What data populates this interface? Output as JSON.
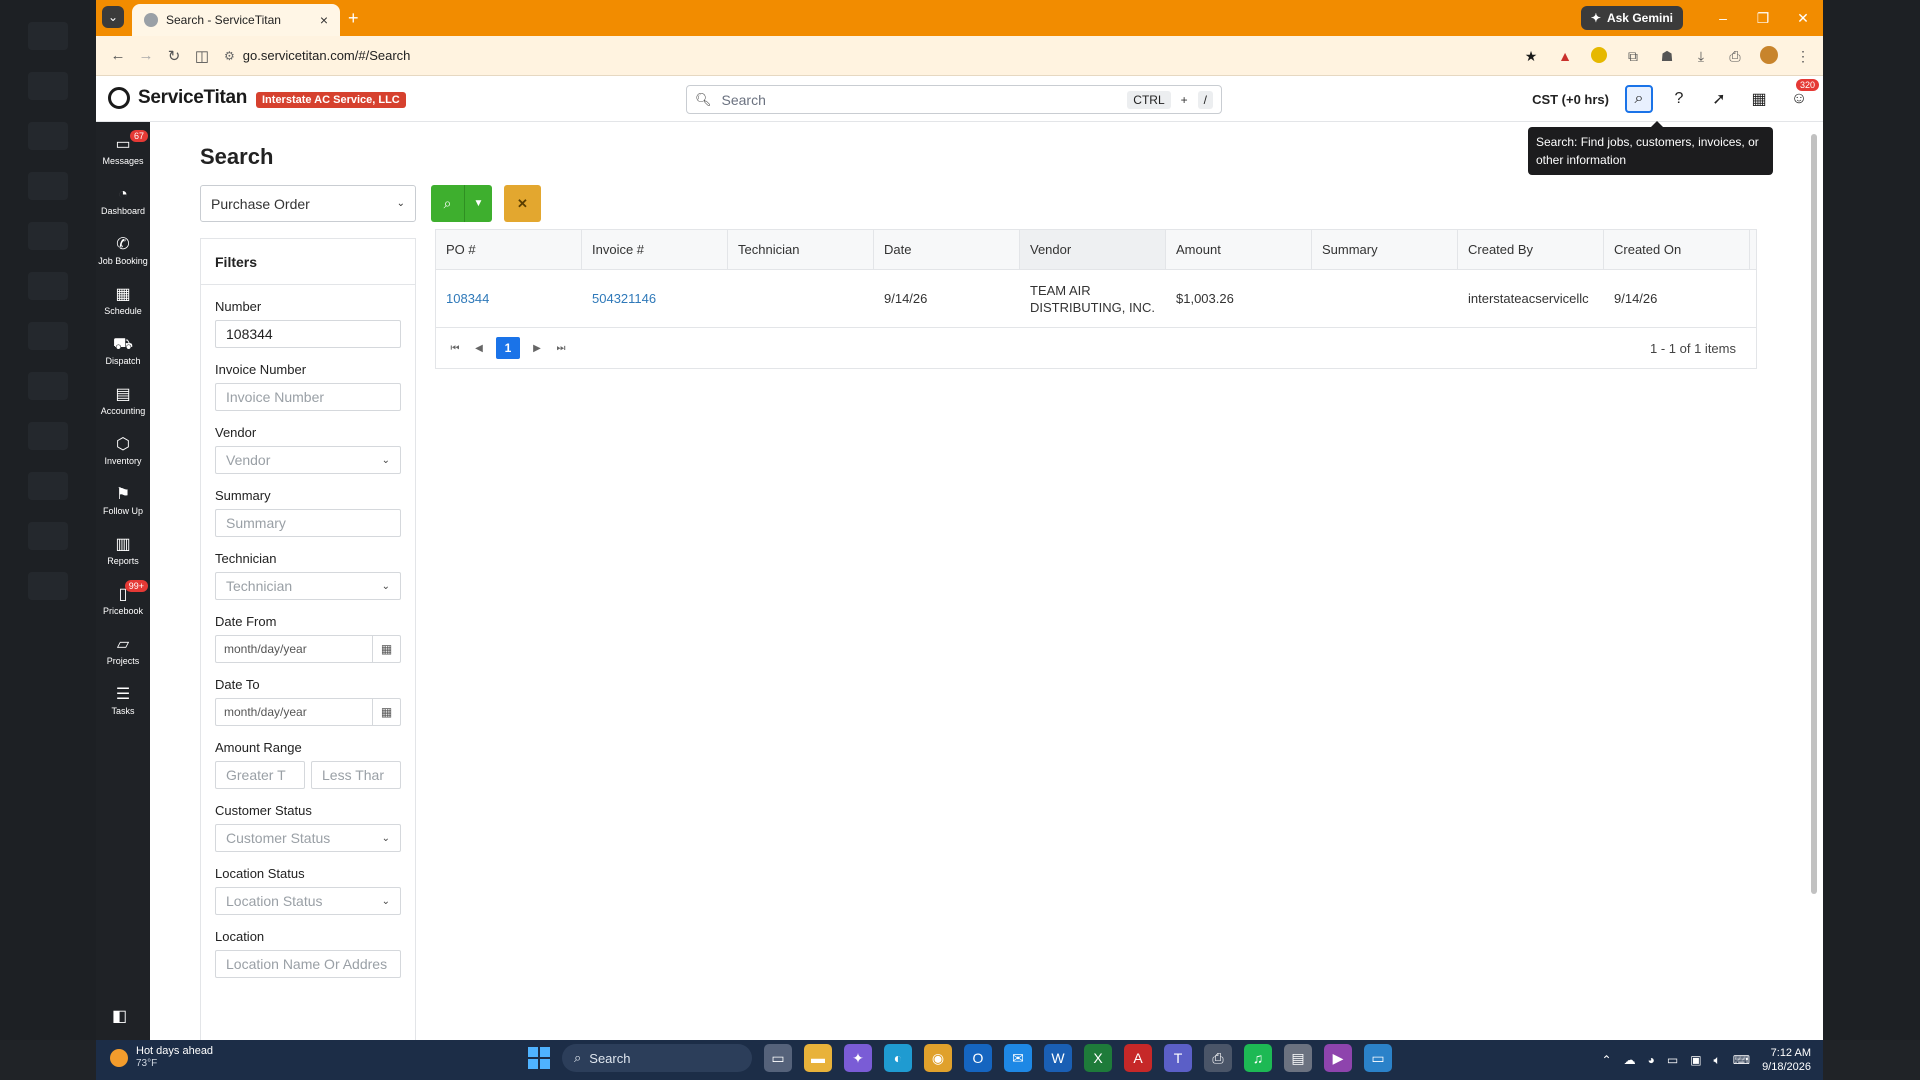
{
  "browser": {
    "tab_title": "Search - ServiceTitan",
    "gemini_label": "Ask Gemini",
    "url": "go.servicetitan.com/#/Search"
  },
  "header": {
    "brand": "ServiceTitan",
    "tenant": "Interstate AC Service, LLC",
    "search_placeholder": "Search",
    "shortcut_key1": "CTRL",
    "shortcut_plus": "+",
    "shortcut_key2": "/",
    "timezone": "CST (+0 hrs)",
    "notifications_count": "320",
    "tooltip": "Search: Find jobs, customers, invoices, or other information"
  },
  "sidebar": {
    "items": [
      {
        "label": "Messages",
        "icon": "chat-icon",
        "badge": "67"
      },
      {
        "label": "Dashboard",
        "icon": "gauge-icon"
      },
      {
        "label": "Job Booking",
        "icon": "phone-icon"
      },
      {
        "label": "Schedule",
        "icon": "calendar-icon"
      },
      {
        "label": "Dispatch",
        "icon": "truck-icon"
      },
      {
        "label": "Accounting",
        "icon": "clipboard-icon"
      },
      {
        "label": "Inventory",
        "icon": "box-icon"
      },
      {
        "label": "Follow Up",
        "icon": "flag-icon"
      },
      {
        "label": "Reports",
        "icon": "bar-chart-icon"
      },
      {
        "label": "Pricebook",
        "icon": "book-icon",
        "badge": "99+"
      },
      {
        "label": "Projects",
        "icon": "folder-icon"
      },
      {
        "label": "Tasks",
        "icon": "list-icon"
      }
    ]
  },
  "page": {
    "title": "Search",
    "search_type": "Purchase Order"
  },
  "filters": {
    "title": "Filters",
    "number_label": "Number",
    "number_value": "108344",
    "invoice_label": "Invoice Number",
    "invoice_placeholder": "Invoice Number",
    "vendor_label": "Vendor",
    "vendor_placeholder": "Vendor",
    "summary_label": "Summary",
    "summary_placeholder": "Summary",
    "technician_label": "Technician",
    "technician_placeholder": "Technician",
    "date_from_label": "Date From",
    "date_from_placeholder": "month/day/year",
    "date_to_label": "Date To",
    "date_to_placeholder": "month/day/year",
    "amount_label": "Amount Range",
    "amount_min_placeholder": "Greater T",
    "amount_max_placeholder": "Less Thar",
    "customer_status_label": "Customer Status",
    "customer_status_placeholder": "Customer Status",
    "location_status_label": "Location Status",
    "location_status_placeholder": "Location Status",
    "location_label": "Location",
    "location_placeholder": "Location Name Or Addres"
  },
  "grid": {
    "columns": [
      "PO #",
      "Invoice #",
      "Technician",
      "Date",
      "Vendor",
      "Amount",
      "Summary",
      "Created By",
      "Created On"
    ],
    "rows": [
      {
        "po": "108344",
        "invoice": "504321146",
        "technician": "",
        "date": "9/14/26",
        "vendor": "TEAM AIR DISTRIBUTING, INC.",
        "amount": "$1,003.26",
        "summary": "",
        "created_by": "interstateacservicellc",
        "created_on": "9/14/26"
      }
    ],
    "current_page": "1",
    "count_text": "1 - 1 of 1 items"
  },
  "taskbar": {
    "weather_title": "Hot days ahead",
    "weather_temp": "73°F",
    "search_label": "Search",
    "time": "7:12 AM",
    "date": "9/18/2026"
  }
}
